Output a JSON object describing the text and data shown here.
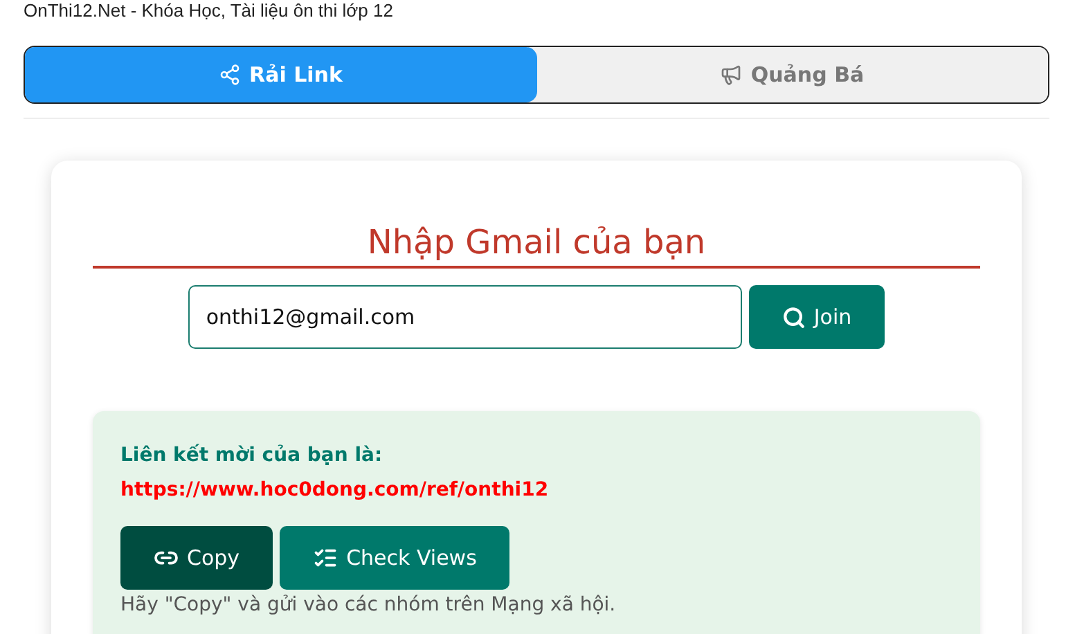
{
  "site_title": "OnThi12.Net - Khóa Học, Tài liệu ôn thi lớp 12",
  "tabs": [
    {
      "label": "Rải Link",
      "selected": true,
      "kind": "share"
    },
    {
      "label": "Quảng Bá",
      "selected": false,
      "kind": "megaphone"
    }
  ],
  "form": {
    "heading": "Nhập Gmail của bạn",
    "email": "onthi12@gmail.com",
    "join_button": "Join"
  },
  "result": {
    "label": "Liên kết mời của bạn là:",
    "link": "https://www.hoc0dong.com/ref/onthi12",
    "buttons": [
      {
        "label": "Copy",
        "kind": "copy"
      },
      {
        "label": "Check Views",
        "kind": "checklist"
      }
    ],
    "hint": "Hãy \"Copy\" và gửi vào các nhóm trên Mạng xã hội."
  }
}
